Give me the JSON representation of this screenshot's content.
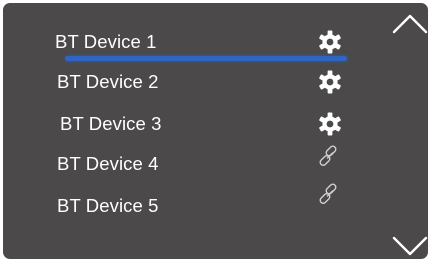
{
  "devices": [
    {
      "label": "BT Device 1",
      "icon": "gear-icon"
    },
    {
      "label": "BT Device 2",
      "icon": "gear-icon"
    },
    {
      "label": "BT Device 3",
      "icon": "gear-icon"
    },
    {
      "label": "BT Device 4",
      "icon": "link-icon"
    },
    {
      "label": "BT Device 5",
      "icon": "link-icon"
    }
  ],
  "selected_index": 0,
  "colors": {
    "panel": "#4b4949",
    "text": "#ffffff",
    "selection": "#2f66c4",
    "link_icon": "#d0d0d0"
  }
}
